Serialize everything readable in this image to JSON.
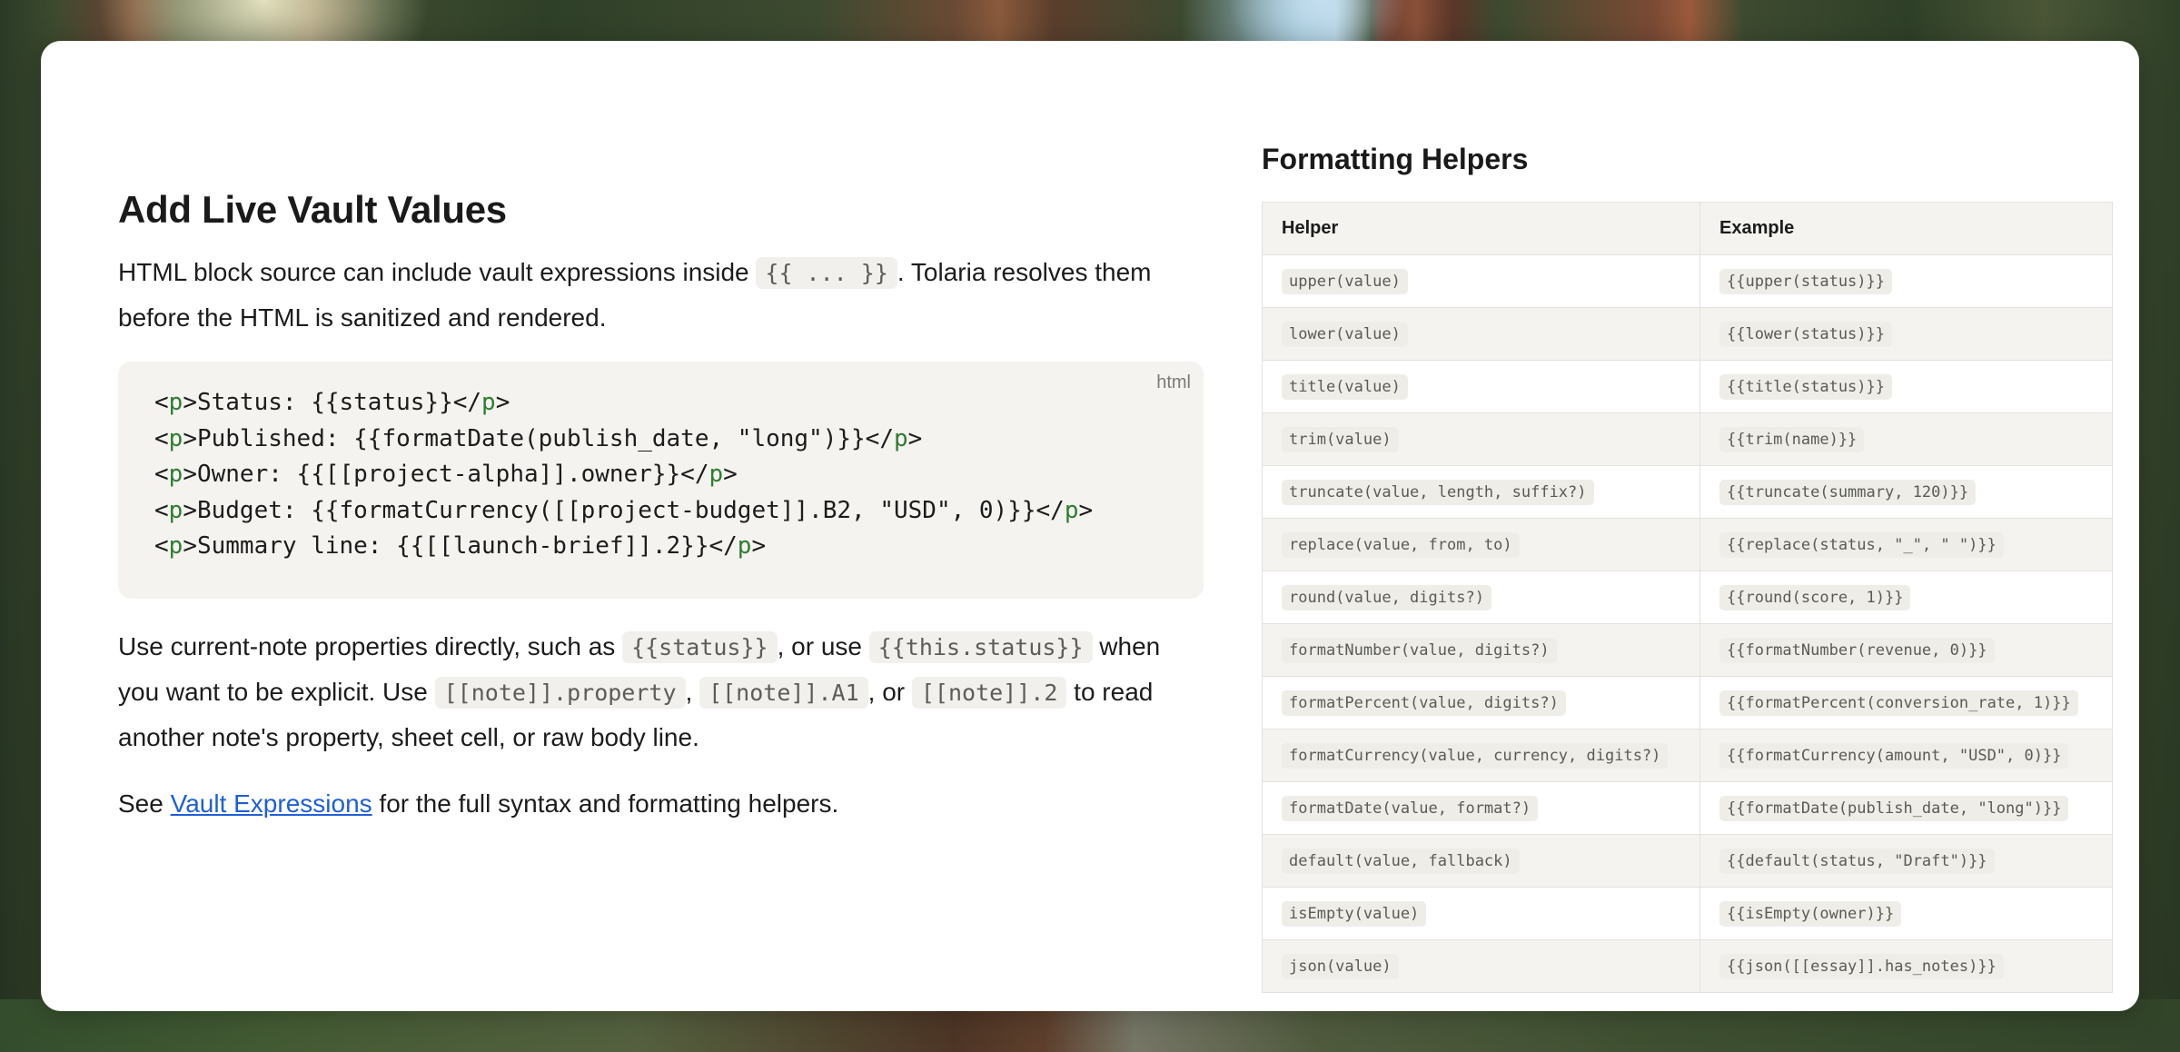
{
  "article": {
    "title": "Add Live Vault Values",
    "intro_before": "HTML block source can include vault expressions inside ",
    "intro_code": "{{ ... }}",
    "intro_after": ". Tolaria resolves them before the HTML is sanitized and rendered.",
    "code_lang": "html",
    "code_lines": [
      {
        "open": "<",
        "tag1": "p",
        "mid": ">Status: {{status}}</",
        "tag2": "p",
        "close": ">"
      },
      {
        "open": "<",
        "tag1": "p",
        "mid": ">Published: {{formatDate(publish_date, \"long\")}}</",
        "tag2": "p",
        "close": ">"
      },
      {
        "open": "<",
        "tag1": "p",
        "mid": ">Owner: {{[[project-alpha]].owner}}</",
        "tag2": "p",
        "close": ">"
      },
      {
        "open": "<",
        "tag1": "p",
        "mid": ">Budget: {{formatCurrency([[project-budget]].B2, \"USD\", 0)}}</",
        "tag2": "p",
        "close": ">"
      },
      {
        "open": "<",
        "tag1": "p",
        "mid": ">Summary line: {{[[launch-brief]].2}}</",
        "tag2": "p",
        "close": ">"
      }
    ],
    "usage": {
      "t1": "Use current-note properties directly, such as ",
      "c1": "{{status}}",
      "t2": ", or use ",
      "c2": "{{this.status}}",
      "t3": " when you want to be explicit. Use ",
      "c3": "[[note]].property",
      "t4": ", ",
      "c4": "[[note]].A1",
      "t5": ", or ",
      "c5": "[[note]].2",
      "t6": " to read another note's property, sheet cell, or raw body line."
    },
    "see": {
      "before": "See ",
      "link": "Vault Expressions",
      "after": " for the full syntax and formatting helpers."
    }
  },
  "helpers": {
    "title": "Formatting Helpers",
    "columns": [
      "Helper",
      "Example"
    ],
    "rows": [
      [
        "upper(value)",
        "{{upper(status)}}"
      ],
      [
        "lower(value)",
        "{{lower(status)}}"
      ],
      [
        "title(value)",
        "{{title(status)}}"
      ],
      [
        "trim(value)",
        "{{trim(name)}}"
      ],
      [
        "truncate(value, length, suffix?)",
        "{{truncate(summary, 120)}}"
      ],
      [
        "replace(value, from, to)",
        "{{replace(status, \"_\", \" \")}}"
      ],
      [
        "round(value, digits?)",
        "{{round(score, 1)}}"
      ],
      [
        "formatNumber(value, digits?)",
        "{{formatNumber(revenue, 0)}}"
      ],
      [
        "formatPercent(value, digits?)",
        "{{formatPercent(conversion_rate, 1)}}"
      ],
      [
        "formatCurrency(value, currency, digits?)",
        "{{formatCurrency(amount, \"USD\", 0)}}"
      ],
      [
        "formatDate(value, format?)",
        "{{formatDate(publish_date, \"long\")}}"
      ],
      [
        "default(value, fallback)",
        "{{default(status, \"Draft\")}}"
      ],
      [
        "isEmpty(value)",
        "{{isEmpty(owner)}}"
      ],
      [
        "json(value)",
        "{{json([[essay]].has_notes)}}"
      ]
    ]
  }
}
